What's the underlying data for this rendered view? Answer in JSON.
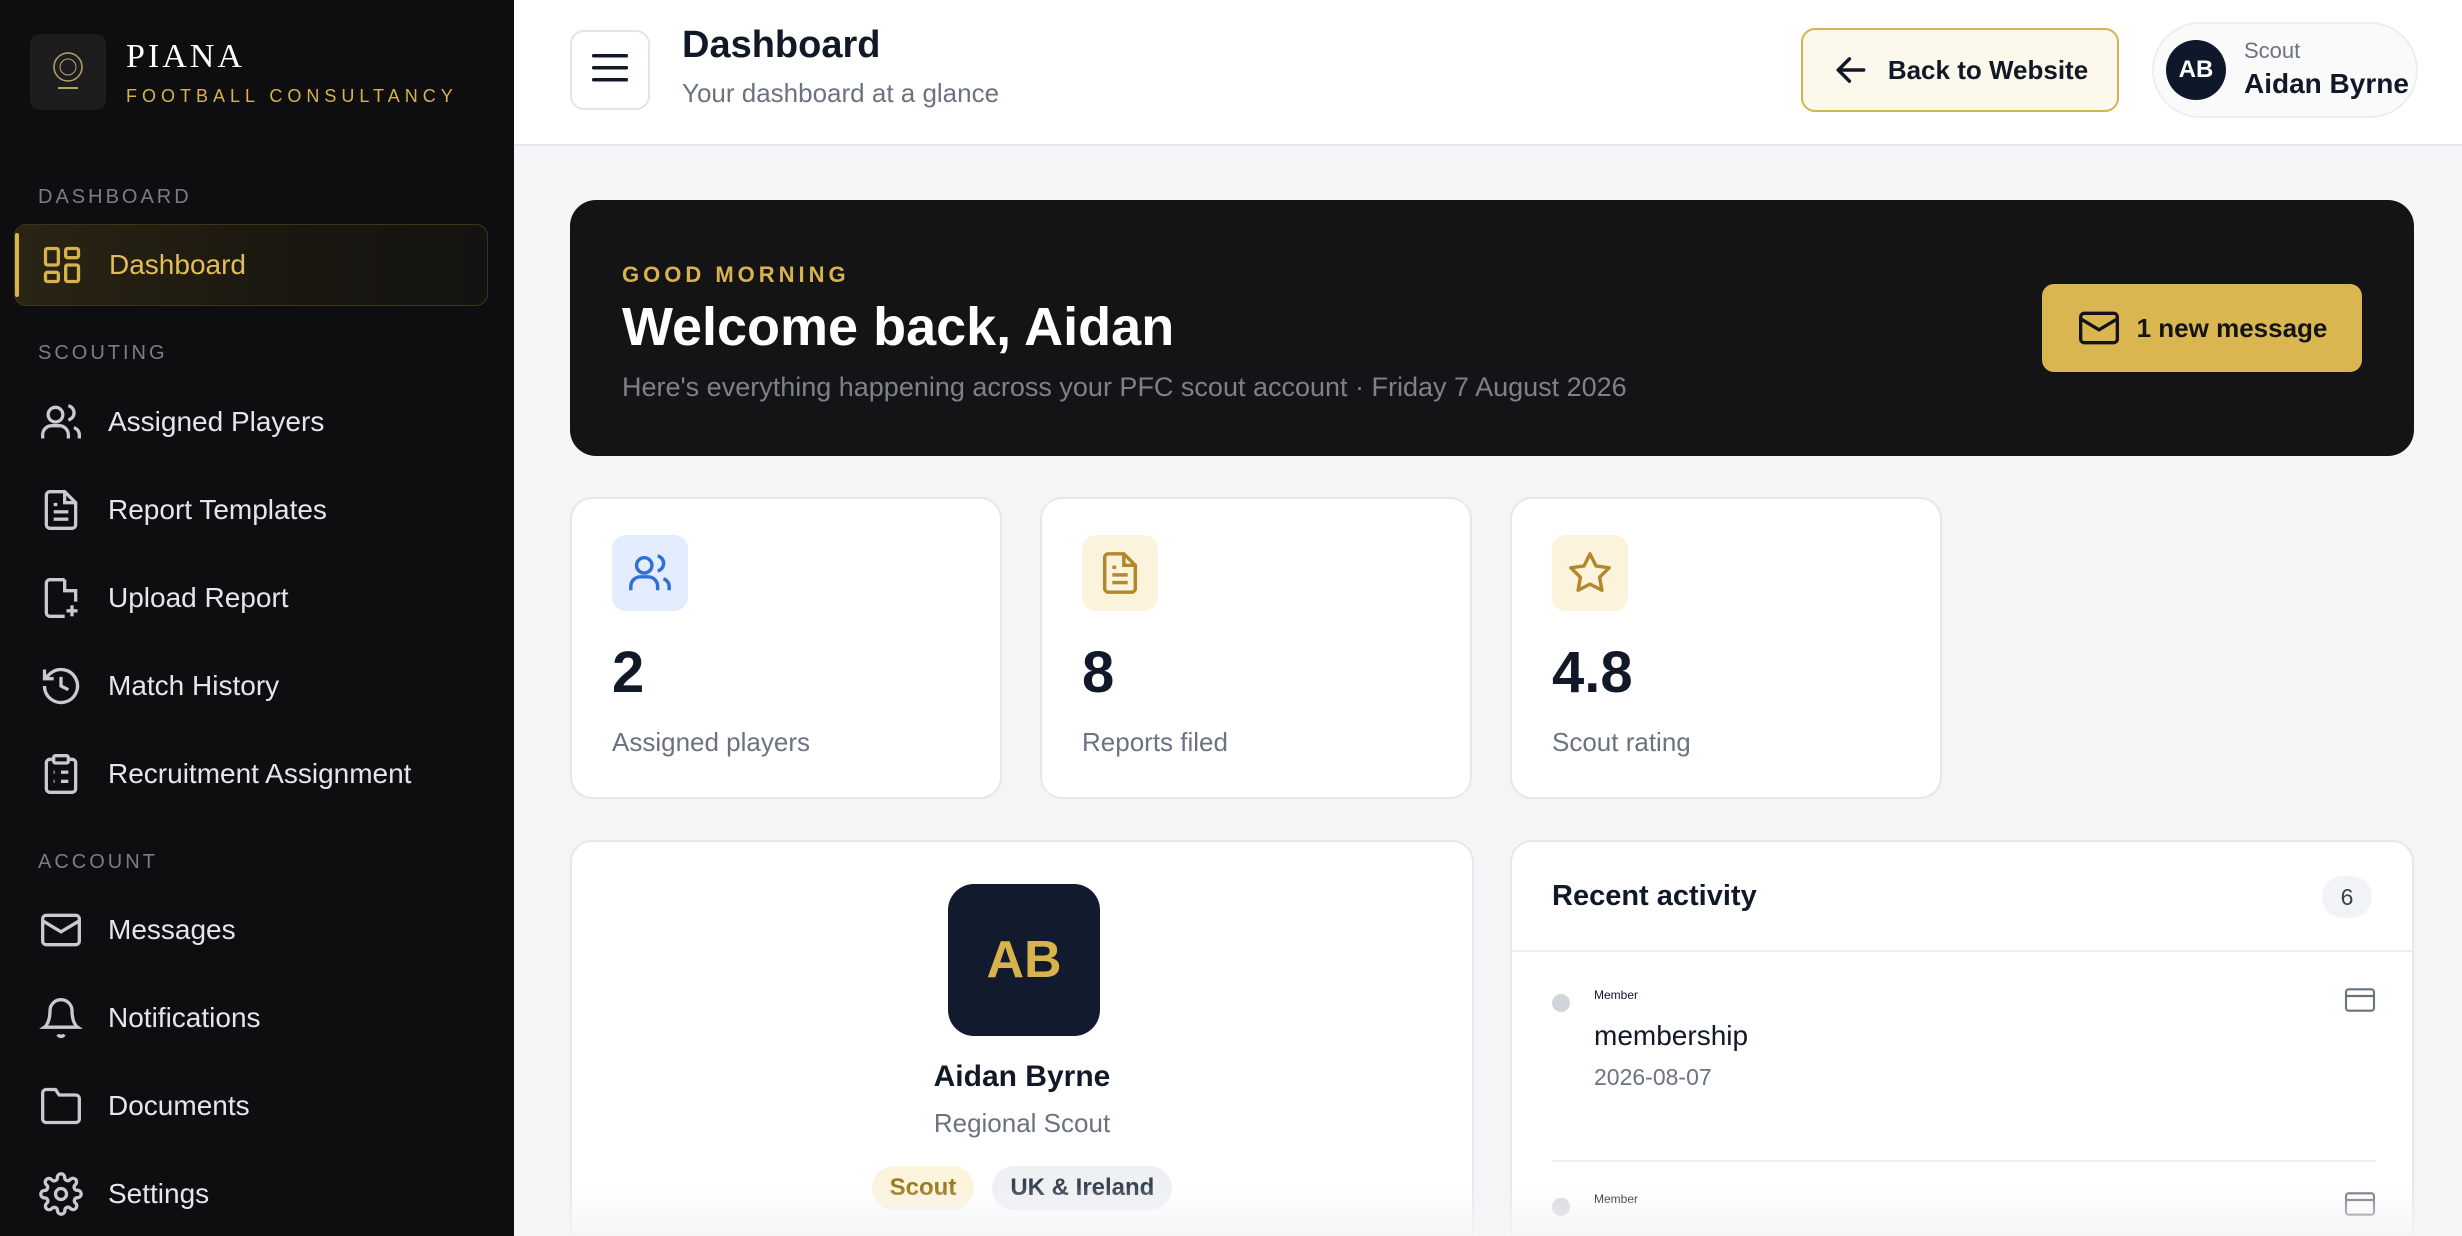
{
  "brand": {
    "name": "PIANA",
    "subtitle": "FOOTBALL CONSULTANCY"
  },
  "sidebar": {
    "sections": [
      {
        "label": "DASHBOARD"
      },
      {
        "label": "SCOUTING"
      },
      {
        "label": "ACCOUNT"
      }
    ],
    "items": [
      {
        "label": "Dashboard",
        "icon": "grid-icon",
        "active": true
      },
      {
        "label": "Assigned Players",
        "icon": "users-icon"
      },
      {
        "label": "Report Templates",
        "icon": "file-text-icon"
      },
      {
        "label": "Upload Report",
        "icon": "file-plus-icon"
      },
      {
        "label": "Match History",
        "icon": "history-icon"
      },
      {
        "label": "Recruitment Assignment",
        "icon": "clipboard-icon"
      },
      {
        "label": "Messages",
        "icon": "mail-icon"
      },
      {
        "label": "Notifications",
        "icon": "bell-icon"
      },
      {
        "label": "Documents",
        "icon": "folder-icon"
      },
      {
        "label": "Settings",
        "icon": "gear-icon"
      }
    ]
  },
  "header": {
    "title": "Dashboard",
    "subtitle": "Your dashboard at a glance",
    "back_label": "Back to Website",
    "user": {
      "initials": "AB",
      "role": "Scout",
      "name": "Aidan Byrne"
    }
  },
  "hero": {
    "eyebrow": "GOOD MORNING",
    "title": "Welcome back, Aidan",
    "subtitle": "Here's everything happening across your PFC scout account · Friday 7 August 2026",
    "message_label": "1 new message"
  },
  "stats": [
    {
      "value": "2",
      "label": "Assigned players",
      "icon": "users-icon",
      "color": "#2f6fd8",
      "bg": "#e3edfd"
    },
    {
      "value": "8",
      "label": "Reports filed",
      "icon": "file-text-icon",
      "color": "#b3882a",
      "bg": "#fbf3dc"
    },
    {
      "value": "4.8",
      "label": "Scout rating",
      "icon": "star-icon",
      "color": "#b3882a",
      "bg": "#fbf3dc"
    }
  ],
  "profile": {
    "initials": "AB",
    "name": "Aidan Byrne",
    "role": "Regional Scout",
    "tags": [
      "Scout",
      "UK & Ireland"
    ]
  },
  "activity": {
    "title": "Recent activity",
    "count": "6",
    "items": [
      {
        "type": "Member",
        "name": "membership",
        "date": "2026-08-07"
      },
      {
        "type": "Member",
        "name": "",
        "date": ""
      }
    ]
  },
  "colors": {
    "accent": "#d7b24d",
    "sidebar_bg": "#0e0e10",
    "hero_bg": "#141417"
  }
}
